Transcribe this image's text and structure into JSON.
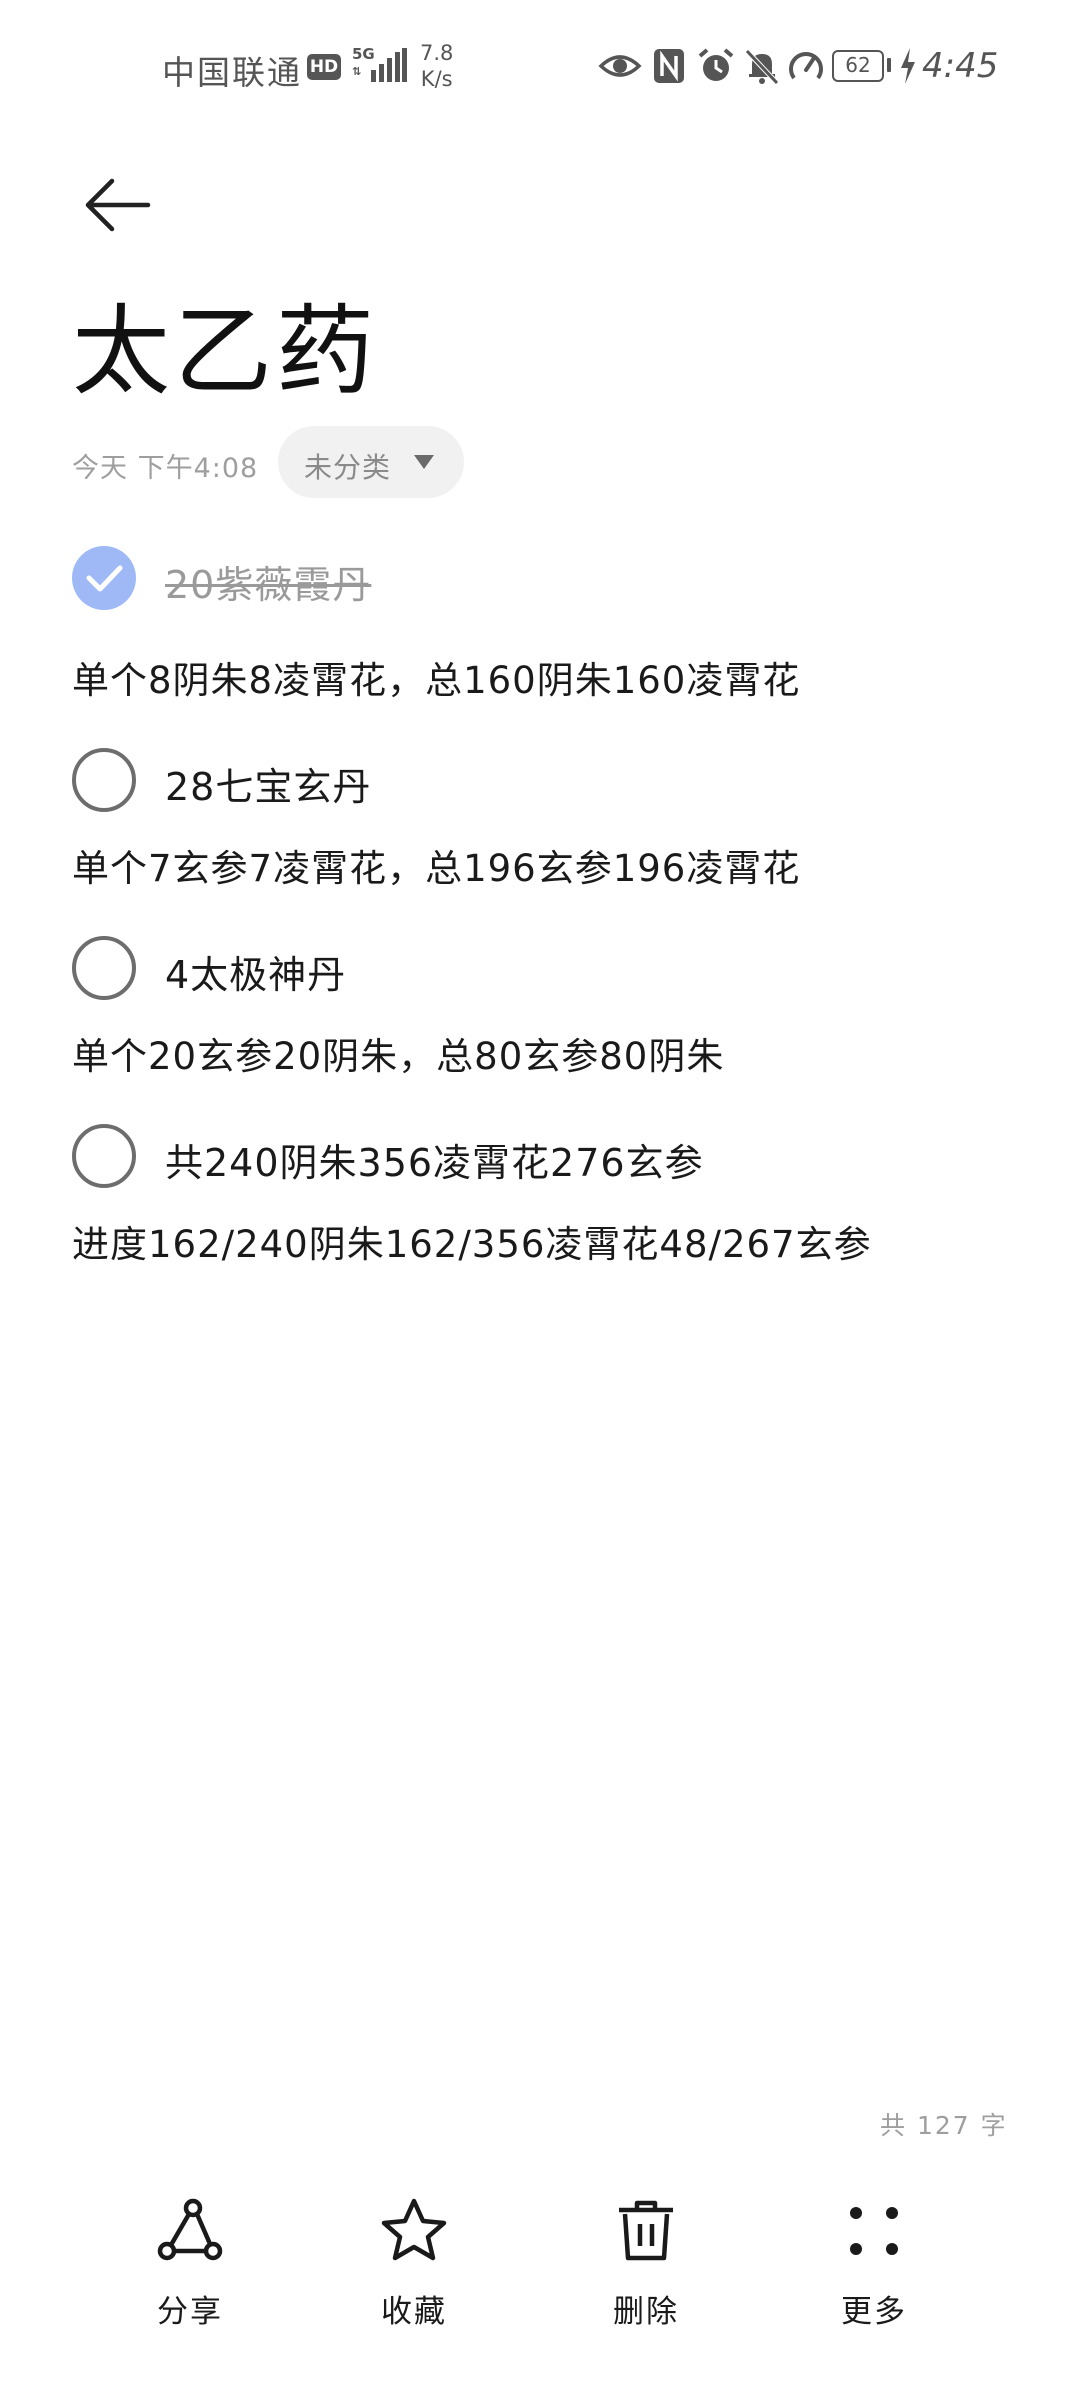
{
  "status_bar": {
    "carrier": "中国联通",
    "hd_badge": "HD",
    "network_type": "5G",
    "net_speed_value": "7.8",
    "net_speed_unit": "K/s",
    "battery_level": "62",
    "time": "4:45"
  },
  "note": {
    "title": "太乙药",
    "date": "今天 下午4:08",
    "category": "未分类",
    "checklist": [
      {
        "text": "20紫薇霞丹",
        "checked": true,
        "detail": "单个8阴朱8凌霄花，总160阴朱160凌霄花"
      },
      {
        "text": "28七宝玄丹",
        "checked": false,
        "detail": "单个7玄参7凌霄花，总196玄参196凌霄花"
      },
      {
        "text": "4太极神丹",
        "checked": false,
        "detail": "单个20玄参20阴朱，总80玄参80阴朱"
      },
      {
        "text": "共240阴朱356凌霄花276玄参",
        "checked": false,
        "detail": "进度162/240阴朱162/356凌霄花48/267玄参"
      }
    ],
    "word_count": "共 127 字"
  },
  "toolbar": {
    "share_label": "分享",
    "favorite_label": "收藏",
    "delete_label": "删除",
    "more_label": "更多"
  },
  "colors": {
    "checked_fill": "#9fb9f7",
    "unchecked_border": "#6d6d6d",
    "chip_bg": "#f1f1f1",
    "meta_text": "#9e9e9e"
  }
}
